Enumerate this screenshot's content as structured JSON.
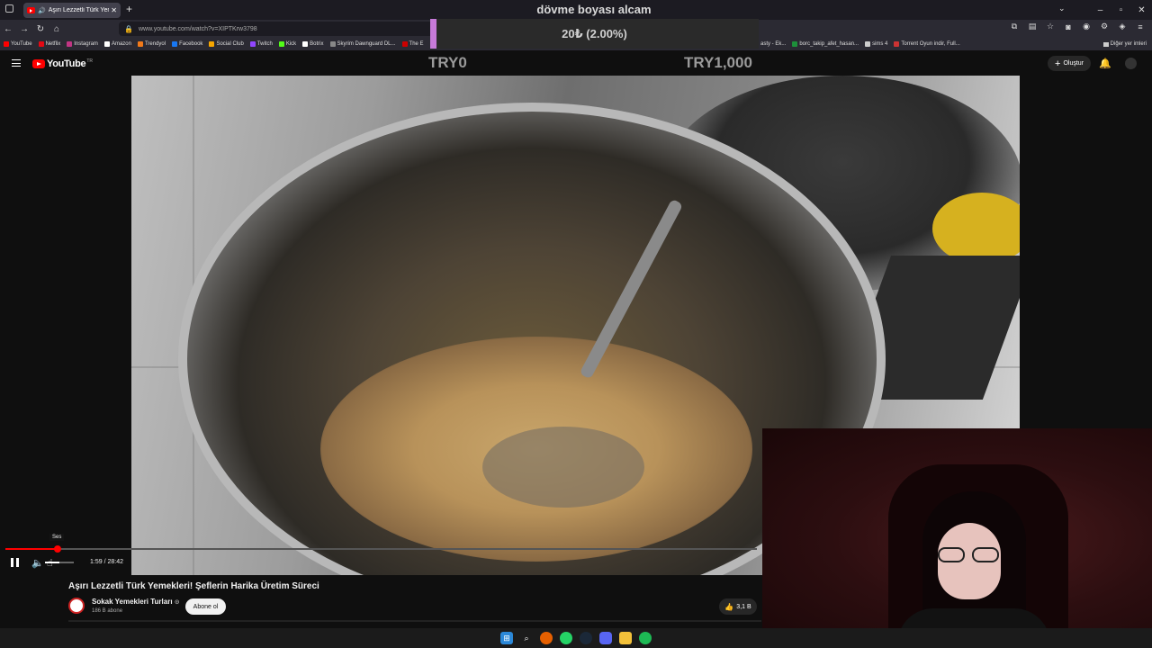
{
  "browser": {
    "tab_title": "Aşırı Lezzetli Türk Yemekleri",
    "tab_close": "✕",
    "new_tab": "+",
    "url": "www.youtube.com/watch?v=XIPTKrw3798",
    "bookmarks": [
      {
        "label": "YouTube",
        "color": "#ff0000"
      },
      {
        "label": "Netflix",
        "color": "#e50914"
      },
      {
        "label": "Instagram",
        "color": "#c13584"
      },
      {
        "label": "Amazon",
        "color": "#ffffff"
      },
      {
        "label": "Trendyol",
        "color": "#f27a1a"
      },
      {
        "label": "Facebook",
        "color": "#1877f2"
      },
      {
        "label": "Social Club",
        "color": "#f7a600"
      },
      {
        "label": "Twitch",
        "color": "#9146ff"
      },
      {
        "label": "Kick",
        "color": "#53fc18"
      },
      {
        "label": "Botrix",
        "color": "#ffffff"
      },
      {
        "label": "Skyrim Dawnguard DL...",
        "color": "#888888"
      },
      {
        "label": "The E",
        "color": "#cc0000"
      }
    ],
    "bookmarks_right": [
      {
        "label": "asty - Ek...",
        "color": "#888888"
      },
      {
        "label": "borc_takip_afet_hasan...",
        "color": "#1d8f3a"
      },
      {
        "label": "sims 4",
        "color": "#cccccc"
      },
      {
        "label": "Torrent Oyun indir, Full...",
        "color": "#cc3333"
      }
    ],
    "other_bookmarks": "Diğer yer imleri"
  },
  "overlay": {
    "title": "dövme boyası alcam",
    "goal_text": "20₺ (2.00%)",
    "goal_progress": 0.02,
    "goal_min": "TRY0",
    "goal_max": "TRY1,000",
    "accent": "#c77ad9"
  },
  "youtube": {
    "logo_text": "YouTube",
    "logo_region": "TR",
    "create_label": "Oluştur",
    "video": {
      "title": "Aşırı Lezzetli Türk Yemekleri! Şeflerin Harika Üretim Süreci",
      "time": "1:59 / 28:42",
      "progress": 0.069,
      "volume": 0.5,
      "tooltip": "Ses"
    },
    "channel": {
      "name": "Sokak Yemekleri Turları",
      "verified": "⊙",
      "subscribers": "186 B abone",
      "subscribe_label": "Abone ol"
    },
    "likes": "3,1 B"
  },
  "colors": {
    "brand_red": "#ff0000",
    "background": "#0f0f0f"
  }
}
